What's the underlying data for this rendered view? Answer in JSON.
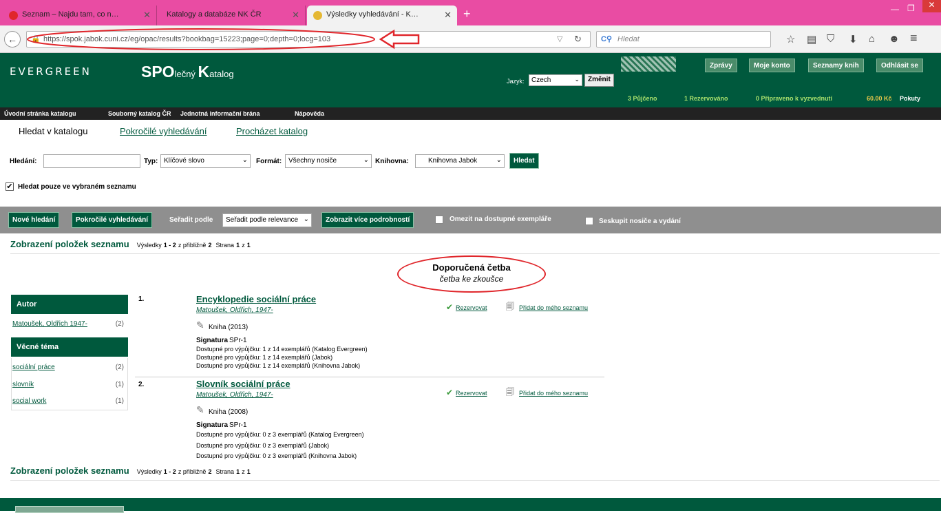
{
  "browser": {
    "tabs": [
      {
        "label": "Seznam – Najdu tam, co n…",
        "active": false
      },
      {
        "label": "Katalogy a databáze NK ČR",
        "active": false
      },
      {
        "label": "Výsledky vyhledávání - K…",
        "active": true
      }
    ],
    "new_tab": "+",
    "url": "https://spok.jabok.cuni.cz/eg/opac/results?bookbag=15223;page=0;depth=0;locg=103",
    "search_placeholder": "Hledat"
  },
  "header": {
    "logo": "EVERGREEN",
    "catalog_name": "SPOlečný Katalog",
    "lang_label": "Jazyk:",
    "lang_value": "Czech",
    "change_button": "Změnit",
    "buttons": [
      "Zprávy",
      "Moje konto",
      "Seznamy knih",
      "Odhlásit se"
    ],
    "stats": {
      "checked_out": "3 Půjčeno",
      "holds": "1 Rezervováno",
      "ready": "0 Připraveno k vyzvednutí",
      "fines_amount": "60.00 Kč",
      "fines_label": "Pokuty"
    }
  },
  "menu": [
    "Úvodní stránka katalogu",
    "Souborný katalog ČR",
    "Jednotná informační brána",
    "Nápověda"
  ],
  "subnav": [
    "Hledat v katalogu",
    "Pokročilé vyhledávání",
    "Procházet katalog"
  ],
  "search": {
    "label": "Hledání:",
    "type_label": "Typ:",
    "type_value": "Klíčové slovo",
    "format_label": "Formát:",
    "format_value": "Všechny nosiče",
    "library_label": "Knihovna:",
    "library_value": "Knihovna Jabok",
    "submit": "Hledat",
    "only_list_label": "Hledat pouze ve vybraném seznamu"
  },
  "toolbar": {
    "new_search": "Nové hledání",
    "advanced": "Pokročilé vyhledávání",
    "sort_label": "Seřadit podle",
    "sort_value": "Seřadit podle relevance",
    "more_details": "Zobrazit více podrobností",
    "limit_available": "Omezit na dostupné exempláře",
    "group_formats": "Seskupit nosiče a vydání"
  },
  "results_header": {
    "title": "Zobrazení položek seznamu",
    "summary_prefix": "Výsledky",
    "range": "1 - 2",
    "approx": "z přibližně",
    "total": "2",
    "page_label": "Strana",
    "page": "1",
    "of": "z",
    "pages": "1"
  },
  "list": {
    "name": "Doporučená četba",
    "description": "četba ke zkoušce"
  },
  "facets": [
    {
      "title": "Autor",
      "items": [
        {
          "label": "Matoušek, Oldřich 1947-",
          "count": "(2)"
        }
      ]
    },
    {
      "title": "Věcné téma",
      "items": [
        {
          "label": "sociální práce",
          "count": "(2)"
        },
        {
          "label": "slovník",
          "count": "(1)"
        },
        {
          "label": "social work",
          "count": "(1)"
        }
      ]
    }
  ],
  "results": [
    {
      "num": "1.",
      "title": "Encyklopedie sociální práce",
      "author": "Matoušek, Oldřich, 1947-",
      "format": "Kniha (2013)",
      "call_label": "Signatura",
      "call_number": "SPr-1",
      "availability": [
        "Dostupné pro výpůjčku: 1 z 14 exemplářů (Katalog Evergreen)",
        "Dostupné pro výpůjčku: 1 z 14 exemplářů (Jabok)",
        "Dostupné pro výpůjčku: 1 z 14 exemplářů (Knihovna Jabok)"
      ],
      "reserve": "Rezervovat",
      "add_list": "Přidat do mého seznamu"
    },
    {
      "num": "2.",
      "title": "Slovník sociální práce",
      "author": "Matoušek, Oldřich, 1947-",
      "format": "Kniha (2008)",
      "call_label": "Signatura",
      "call_number": "SPr-1",
      "availability": [
        "Dostupné pro výpůjčku: 0 z 3 exemplářů (Katalog Evergreen)",
        "Dostupné pro výpůjčku: 0 z 3 exemplářů (Jabok)",
        "Dostupné pro výpůjčku: 0 z 3 exemplářů (Knihovna Jabok)"
      ],
      "reserve": "Rezervovat",
      "add_list": "Přidat do mého seznamu"
    }
  ],
  "colors": {
    "brand_green": "#00593d",
    "tabbar_pink": "#e94ca3",
    "annotation_red": "#e0262b"
  }
}
